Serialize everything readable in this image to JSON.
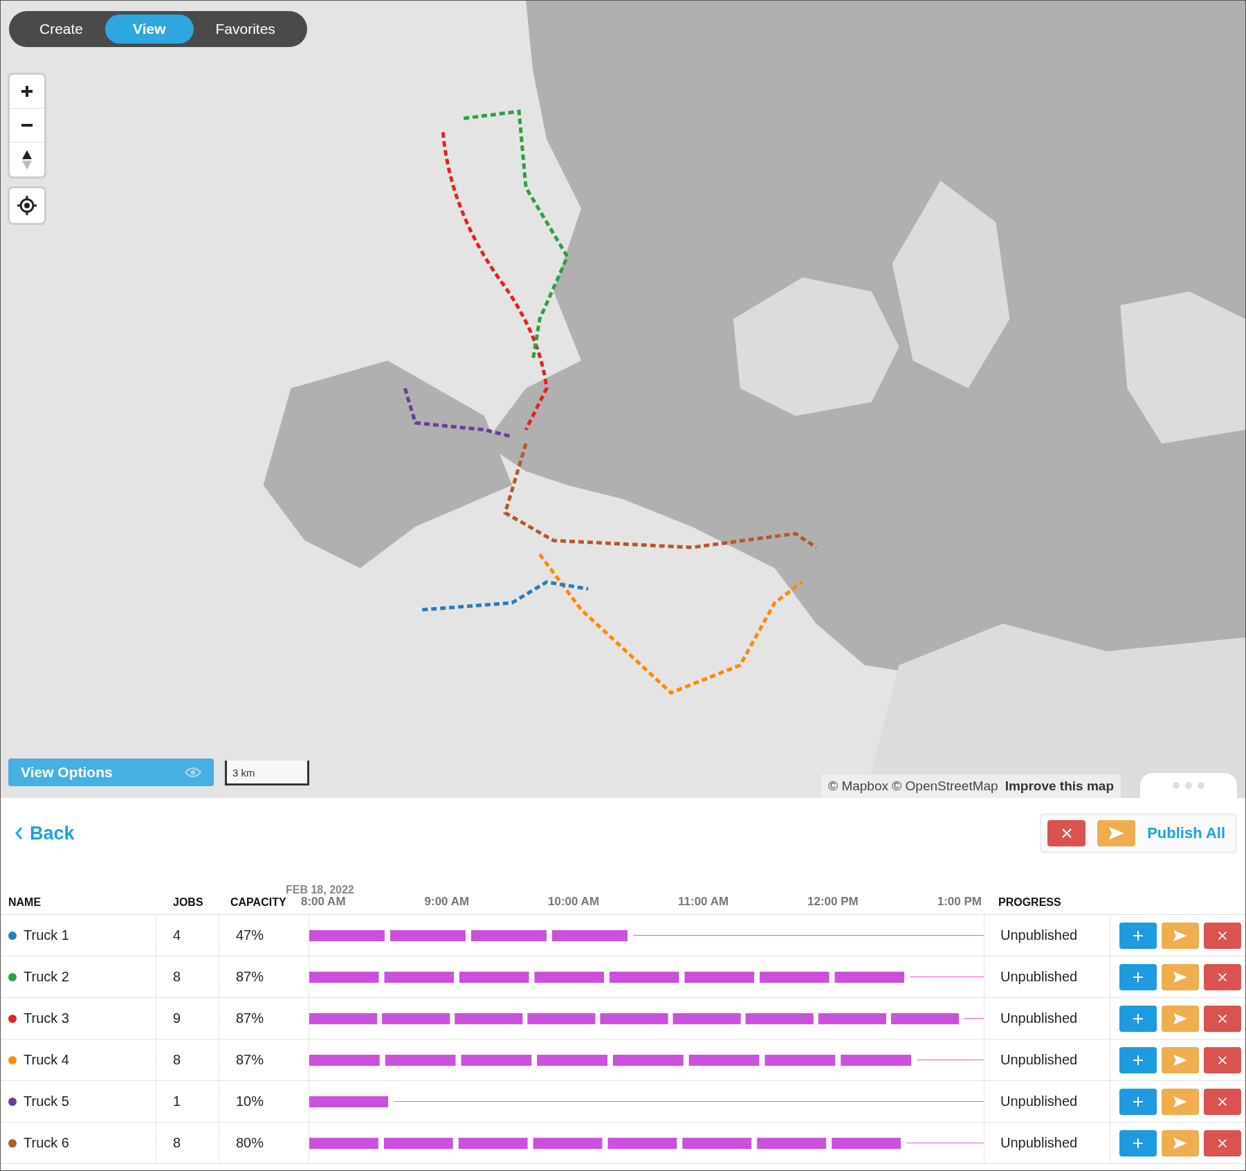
{
  "mode_tabs": [
    {
      "label": "Create",
      "selected": false
    },
    {
      "label": "View",
      "selected": true
    },
    {
      "label": "Favorites",
      "selected": false
    }
  ],
  "map": {
    "kind": "picture",
    "view_options": "View Options",
    "scale": "3 km",
    "attribution": "© Mapbox © OpenStreetMap",
    "attribution_link": "Improve this map"
  },
  "back": "Back",
  "publish_all": "Publish All",
  "columns": {
    "name": "NAME",
    "jobs": "JOBS",
    "capacity": "CAPACITY",
    "progress": "PROGRESS"
  },
  "timeline": {
    "date": "FEB 18, 2022",
    "ticks": [
      "8:00 AM",
      "9:00 AM",
      "10:00 AM",
      "11:00 AM",
      "12:00 PM",
      "1:00 PM"
    ]
  },
  "rows": [
    {
      "name": "Truck 1",
      "color": "#2a7bbf",
      "jobs": "4",
      "capacity": "47%",
      "level": 0.48,
      "progress": "Unpublished"
    },
    {
      "name": "Truck 2",
      "color": "#2ea043",
      "jobs": "8",
      "capacity": "87%",
      "level": 0.89,
      "progress": "Unpublished"
    },
    {
      "name": "Truck 3",
      "color": "#e02424",
      "jobs": "9",
      "capacity": "87%",
      "level": 0.97,
      "progress": "Unpublished"
    },
    {
      "name": "Truck 4",
      "color": "#ff8a00",
      "jobs": "8",
      "capacity": "87%",
      "level": 0.9,
      "progress": "Unpublished"
    },
    {
      "name": "Truck 5",
      "color": "#6a3d9a",
      "jobs": "1",
      "capacity": "10%",
      "level": 0.126,
      "progress": "Unpublished"
    },
    {
      "name": "Truck 6",
      "color": "#b5582a",
      "jobs": "8",
      "capacity": "80%",
      "level": 0.885,
      "progress": "Unpublished"
    }
  ]
}
